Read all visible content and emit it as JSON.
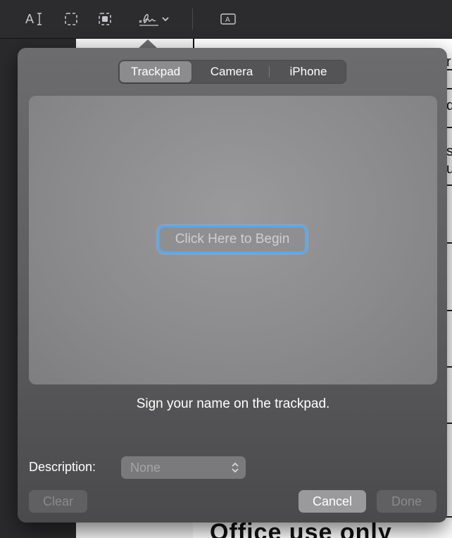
{
  "toolbar": {
    "tools": [
      {
        "name": "text-selection-icon",
        "label": "A"
      },
      {
        "name": "rectangular-selection-icon"
      },
      {
        "name": "smart-lasso-icon"
      },
      {
        "name": "sign-icon"
      },
      {
        "name": "text-box-icon",
        "label": "A"
      }
    ]
  },
  "signature_popover": {
    "tabs": [
      {
        "label": "Trackpad",
        "active": true
      },
      {
        "label": "Camera",
        "active": false
      },
      {
        "label": "iPhone",
        "active": false
      }
    ],
    "begin_button_label": "Click Here to Begin",
    "instruction": "Sign your name on the trackpad.",
    "description_label": "Description:",
    "description_value": "None",
    "clear_label": "Clear",
    "cancel_label": "Cancel",
    "done_label": "Done"
  },
  "background_document": {
    "footer_text": "Office use only",
    "edge_chars": [
      "r",
      "d",
      "s",
      "u"
    ]
  },
  "colors": {
    "focus_ring": "#5aa8ec",
    "toolbar_bg": "#2c2c2e",
    "popover_bg": "#6c6c6e"
  }
}
